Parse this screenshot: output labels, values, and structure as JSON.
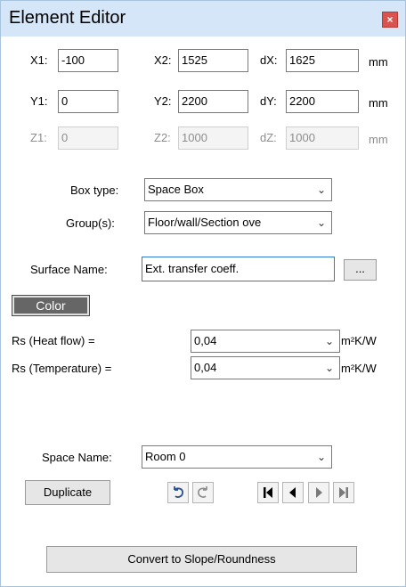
{
  "window": {
    "title": "Element Editor",
    "close_glyph": "×"
  },
  "coords": {
    "rows": [
      {
        "a_label": "X1:",
        "a_value": "-100",
        "b_label": "X2:",
        "b_value": "1525",
        "c_label": "dX:",
        "c_value": "1625",
        "unit": "mm",
        "disabled": false
      },
      {
        "a_label": "Y1:",
        "a_value": "0",
        "b_label": "Y2:",
        "b_value": "2200",
        "c_label": "dY:",
        "c_value": "2200",
        "unit": "mm",
        "disabled": false
      },
      {
        "a_label": "Z1:",
        "a_value": "0",
        "b_label": "Z2:",
        "b_value": "1000",
        "c_label": "dZ:",
        "c_value": "1000",
        "unit": "mm",
        "disabled": true
      }
    ]
  },
  "box_type": {
    "label": "Box type:",
    "value": "Space Box"
  },
  "groups": {
    "label": "Group(s):",
    "value": "Floor/wall/Section ove"
  },
  "surface": {
    "label": "Surface Name:",
    "value": "Ext. transfer coeff.",
    "browse_label": "..."
  },
  "color_button": {
    "label": "Color",
    "swatch_color": "#666666"
  },
  "rs_heat": {
    "label": "Rs (Heat flow) =",
    "value": "0,04",
    "unit": "m²K/W"
  },
  "rs_temp": {
    "label": "Rs (Temperature) =",
    "value": "0,04",
    "unit": "m²K/W"
  },
  "space": {
    "label": "Space Name:",
    "value": "Room 0"
  },
  "duplicate_label": "Duplicate",
  "convert_label": "Convert to Slope/Roundness",
  "icons": {
    "undo": "undo-icon",
    "redo": "redo-icon",
    "first": "first-icon",
    "prev": "prev-icon",
    "next": "next-icon",
    "last": "last-icon"
  }
}
